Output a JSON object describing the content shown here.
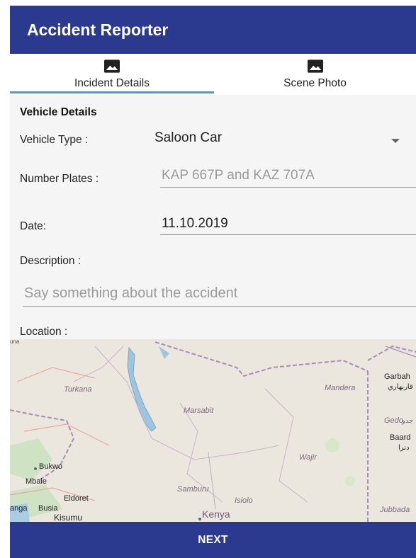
{
  "appbar": {
    "title": "Accident Reporter",
    "color": "#2b3a8f"
  },
  "tabs": [
    {
      "label": "Incident Details",
      "icon": "image-icon",
      "selected": true
    },
    {
      "label": "Scene Photo",
      "icon": "image-icon",
      "selected": false
    }
  ],
  "form": {
    "section_title": "Vehicle Details",
    "vehicle_type": {
      "label": "Vehicle Type :",
      "value": "Saloon Car"
    },
    "number_plates": {
      "label": "Number Plates :",
      "placeholder": "KAP 667P and KAZ 707A"
    },
    "date": {
      "label": "Date:",
      "value": "11.10.2019"
    },
    "description": {
      "label": "Description :",
      "placeholder": "Say something about the accident"
    },
    "location": {
      "label": "Location :"
    }
  },
  "map": {
    "places": [
      "Turkana",
      "Marsabit",
      "Mandera",
      "Garbah",
      "Gedo",
      "Baard",
      "Wajir",
      "Bukwo",
      "Samburu",
      "Isiolo",
      "Mbale",
      "Eldoret",
      "Busia",
      "Kenya",
      "Kisumu",
      "Jubbada"
    ],
    "arabic_labels": [
      "قاربهاري",
      "جدو",
      "دنرا"
    ],
    "partial_labels": [
      "anga",
      "una"
    ]
  },
  "footer": {
    "next_label": "NEXT"
  }
}
